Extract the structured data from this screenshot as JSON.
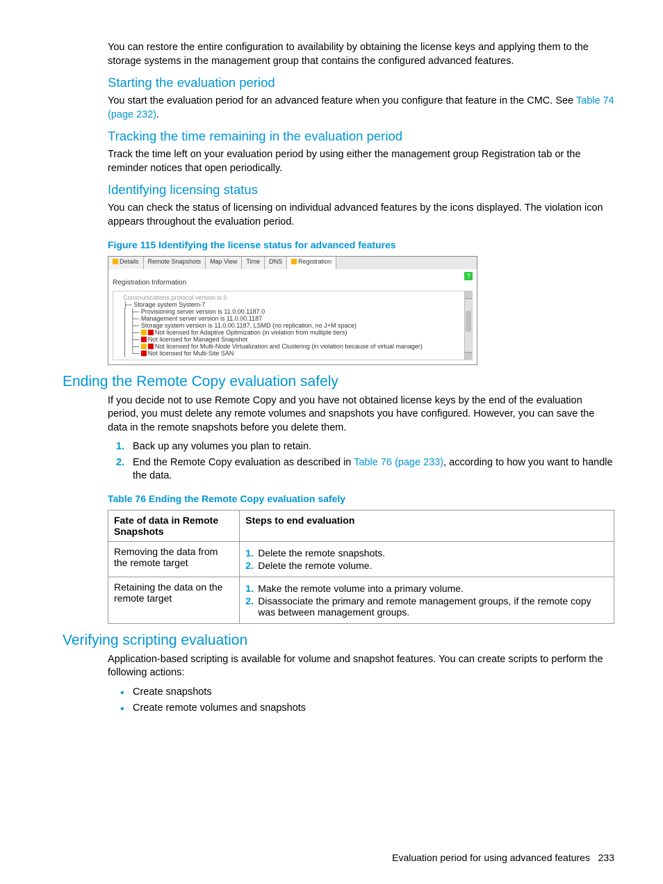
{
  "intro": {
    "p1": "You can restore the entire configuration to availability by obtaining the license keys and applying them to the storage systems in the management group that contains the configured advanced features."
  },
  "sections": {
    "starting": {
      "title": "Starting the evaluation period",
      "body_before": "You start the evaluation period for an advanced feature when you configure that feature in the CMC. See ",
      "link": "Table 74 (page 232)",
      "body_after": "."
    },
    "tracking": {
      "title": "Tracking the time remaining in the evaluation period",
      "body": "Track the time left on your evaluation period by using either the management group Registration tab or the reminder notices that open periodically."
    },
    "identifying": {
      "title": "Identifying licensing status",
      "body": "You can check the status of licensing on individual advanced features by the icons displayed. The violation icon appears throughout the evaluation period.",
      "figcap": "Figure 115 Identifying the license status for advanced features",
      "figure": {
        "tabs": [
          "Details",
          "Remote Snapshots",
          "Map View",
          "Time",
          "DNS",
          "Registration"
        ],
        "reg_title": "Registration Information",
        "tree_lines": [
          "Communications protocol version is 0",
          "Storage system System-7",
          "Provisioning server version is 11.0.00.1187.0",
          "Management server version is 11.0.00.1187",
          "Storage system version is 11.0.00.1187, LSMD (no replication, no J+M space)",
          "Not licensed for Adaptive Optimization (in violation from multiple tiers)",
          "Not licensed for Managed Snapshot",
          "Not licensed for Multi-Node Virtualization and Clustering (in violation because of virtual manager)",
          "Not licensed for Multi-Site SAN"
        ]
      }
    },
    "ending": {
      "title": "Ending the Remote Copy evaluation safely",
      "body": "If you decide not to use Remote Copy and you have not obtained license keys by the end of the evaluation period, you must delete any remote volumes and snapshots you have configured. However, you can save the data in the remote snapshots before you delete them.",
      "list": {
        "item1": "Back up any volumes you plan to retain.",
        "item2_before": "End the Remote Copy evaluation as described in ",
        "item2_link": "Table 76 (page 233)",
        "item2_after": ", according to how you want to handle the data."
      },
      "tabcap": "Table 76 Ending the Remote Copy evaluation safely",
      "table": {
        "head1": "Fate of data in Remote Snapshots",
        "head2": "Steps to end evaluation",
        "row1": {
          "c1": "Removing the data from the remote target",
          "step1": "Delete the remote snapshots.",
          "step2": "Delete the remote volume."
        },
        "row2": {
          "c1": "Retaining the data on the remote target",
          "step1": "Make the remote volume into a primary volume.",
          "step2": "Disassociate the primary and remote management groups, if the remote copy was between management groups."
        }
      }
    },
    "verifying": {
      "title": "Verifying scripting evaluation",
      "body": "Application-based scripting is available for volume and snapshot features. You can create scripts to perform the following actions:",
      "bullets": {
        "b1": "Create snapshots",
        "b2": "Create remote volumes and snapshots"
      }
    }
  },
  "footer": {
    "title": "Evaluation period for using advanced features",
    "page": "233"
  }
}
